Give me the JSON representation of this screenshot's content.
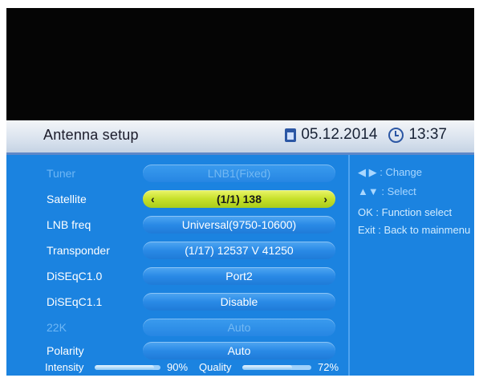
{
  "header": {
    "title": "Antenna setup",
    "date": "05.12.2014",
    "time": "13:37",
    "icons": [
      "calendar-icon",
      "clock-icon"
    ]
  },
  "rows": [
    {
      "label": "Tuner",
      "value": "LNB1(Fixed)",
      "state": "disabled"
    },
    {
      "label": "Satellite",
      "value": "(1/1) 138",
      "state": "selected"
    },
    {
      "label": "LNB freq",
      "value": "Universal(9750-10600)",
      "state": "normal"
    },
    {
      "label": "Transponder",
      "value": "(1/17) 12537 V 41250",
      "state": "normal"
    },
    {
      "label": "DiSEqC1.0",
      "value": "Port2",
      "state": "normal"
    },
    {
      "label": "DiSEqC1.1",
      "value": "Disable",
      "state": "normal"
    },
    {
      "label": "22K",
      "value": "Auto",
      "state": "disabled"
    },
    {
      "label": "Polarity",
      "value": "Auto",
      "state": "normal"
    }
  ],
  "help": [
    {
      "keys": "◀ ▶",
      "text": ": Change"
    },
    {
      "keys": "▲▼",
      "text": ": Select"
    },
    {
      "keys": "OK",
      "text": ": Function select"
    },
    {
      "keys": "Exit",
      "text": ": Back to mainmenu"
    }
  ],
  "signal": {
    "intensity_label": "Intensity",
    "intensity_value": "90%",
    "intensity_fraction": 0.9,
    "quality_label": "Quality",
    "quality_value": "72%",
    "quality_fraction": 0.72
  },
  "colors": {
    "panel": "#1b83e0",
    "selected": "#c6e02a",
    "header_border": "#5f87c8"
  }
}
